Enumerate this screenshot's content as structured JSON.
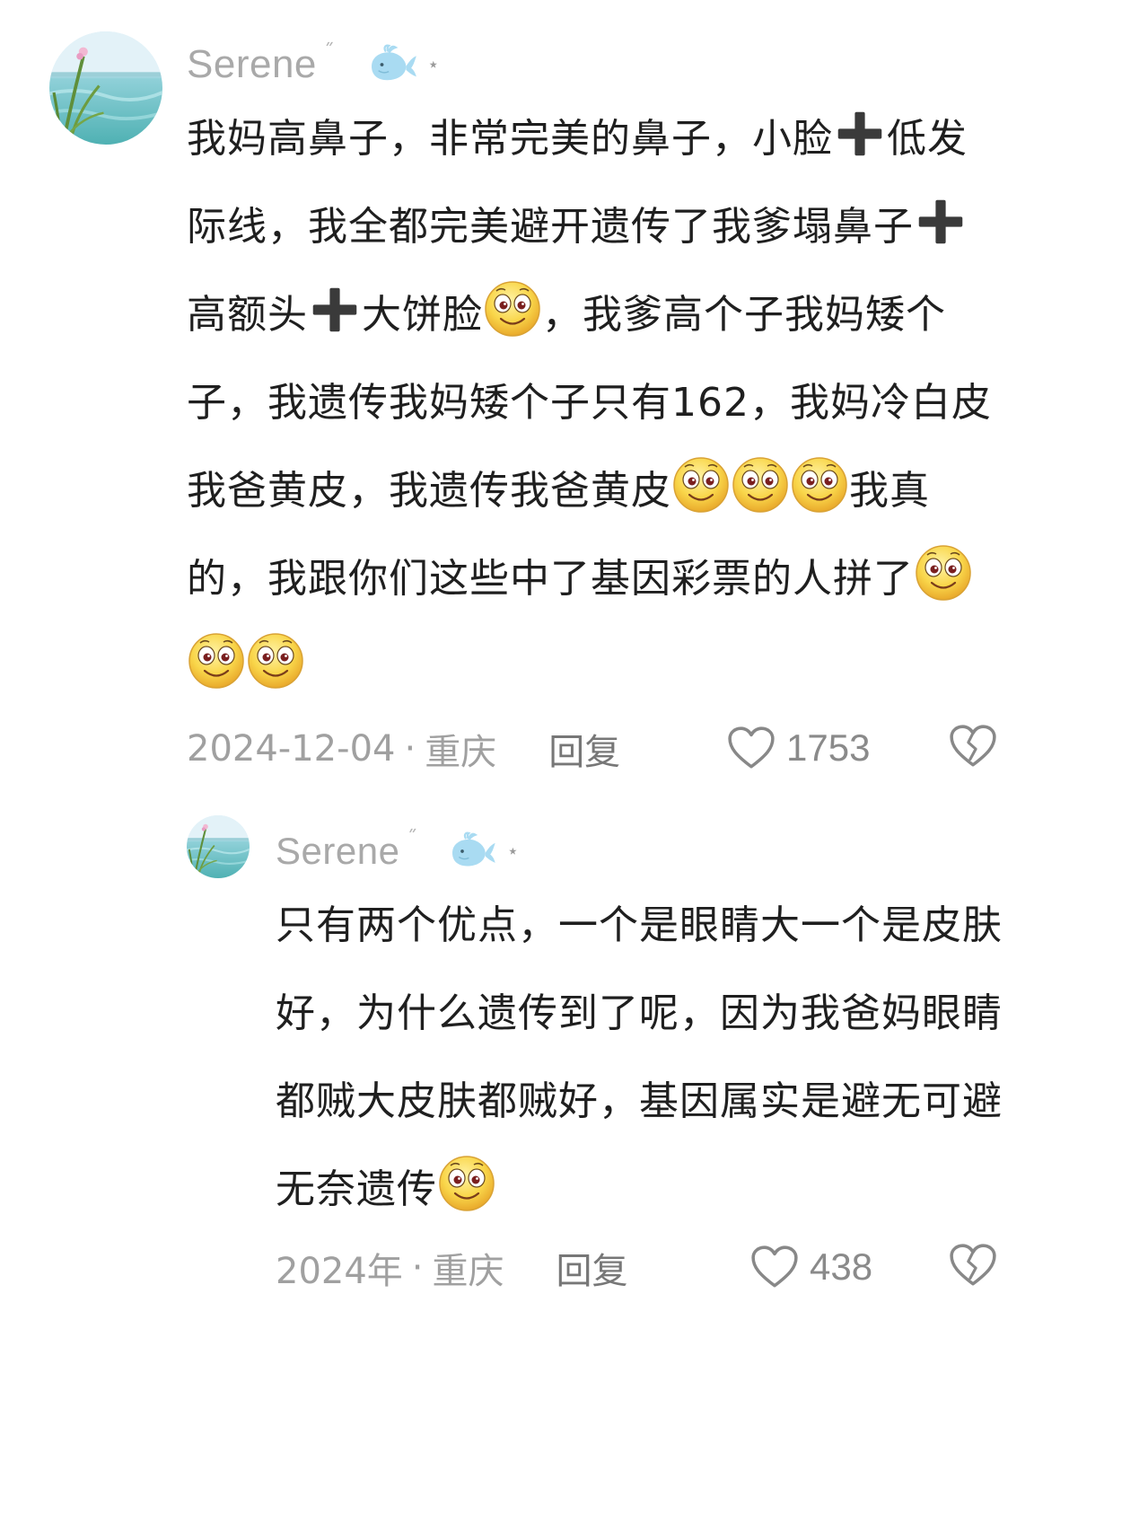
{
  "comments": [
    {
      "username": "Serene",
      "name_mark": "˝",
      "badge_icon": "whale-icon",
      "star": "⋆",
      "text_parts": [
        "我妈高鼻子，非常完美的鼻子，小脸",
        "低发际线，我全都完美避开遗传了我爹塌鼻子",
        "高额头",
        "大饼脸",
        "，我爹高个子我妈矮个子，我遗传我妈矮个子只有162，我妈冷白皮我爸黄皮，我遗传我爸黄皮",
        "我真的，我跟你们这些中了基因彩票的人拼了"
      ],
      "date": "2024-12-04",
      "location": "重庆",
      "separator": "·",
      "reply_label": "回复",
      "likes": "1753"
    },
    {
      "username": "Serene",
      "name_mark": "˝",
      "badge_icon": "whale-icon",
      "star": "⋆",
      "text_parts": [
        "只有两个优点，一个是眼睛大一个是皮肤好，为什么遗传到了呢，因为我爸妈眼睛都贼大皮肤都贼好，基因属实是避无可避无奈遗传"
      ],
      "date": "2024年",
      "location": "重庆",
      "separator": "·",
      "reply_label": "回复",
      "likes": "438"
    }
  ],
  "icons": {
    "emoji": "smile-emoji-icon",
    "plus": "heavy-plus-icon",
    "like": "heart-outline-icon",
    "dislike": "broken-heart-icon"
  },
  "colors": {
    "text": "#1f1f1f",
    "meta": "#a0a0a0",
    "username": "#a9a9a9",
    "emoji_face": "#f7d54a",
    "whale": "#a9dbf2"
  }
}
